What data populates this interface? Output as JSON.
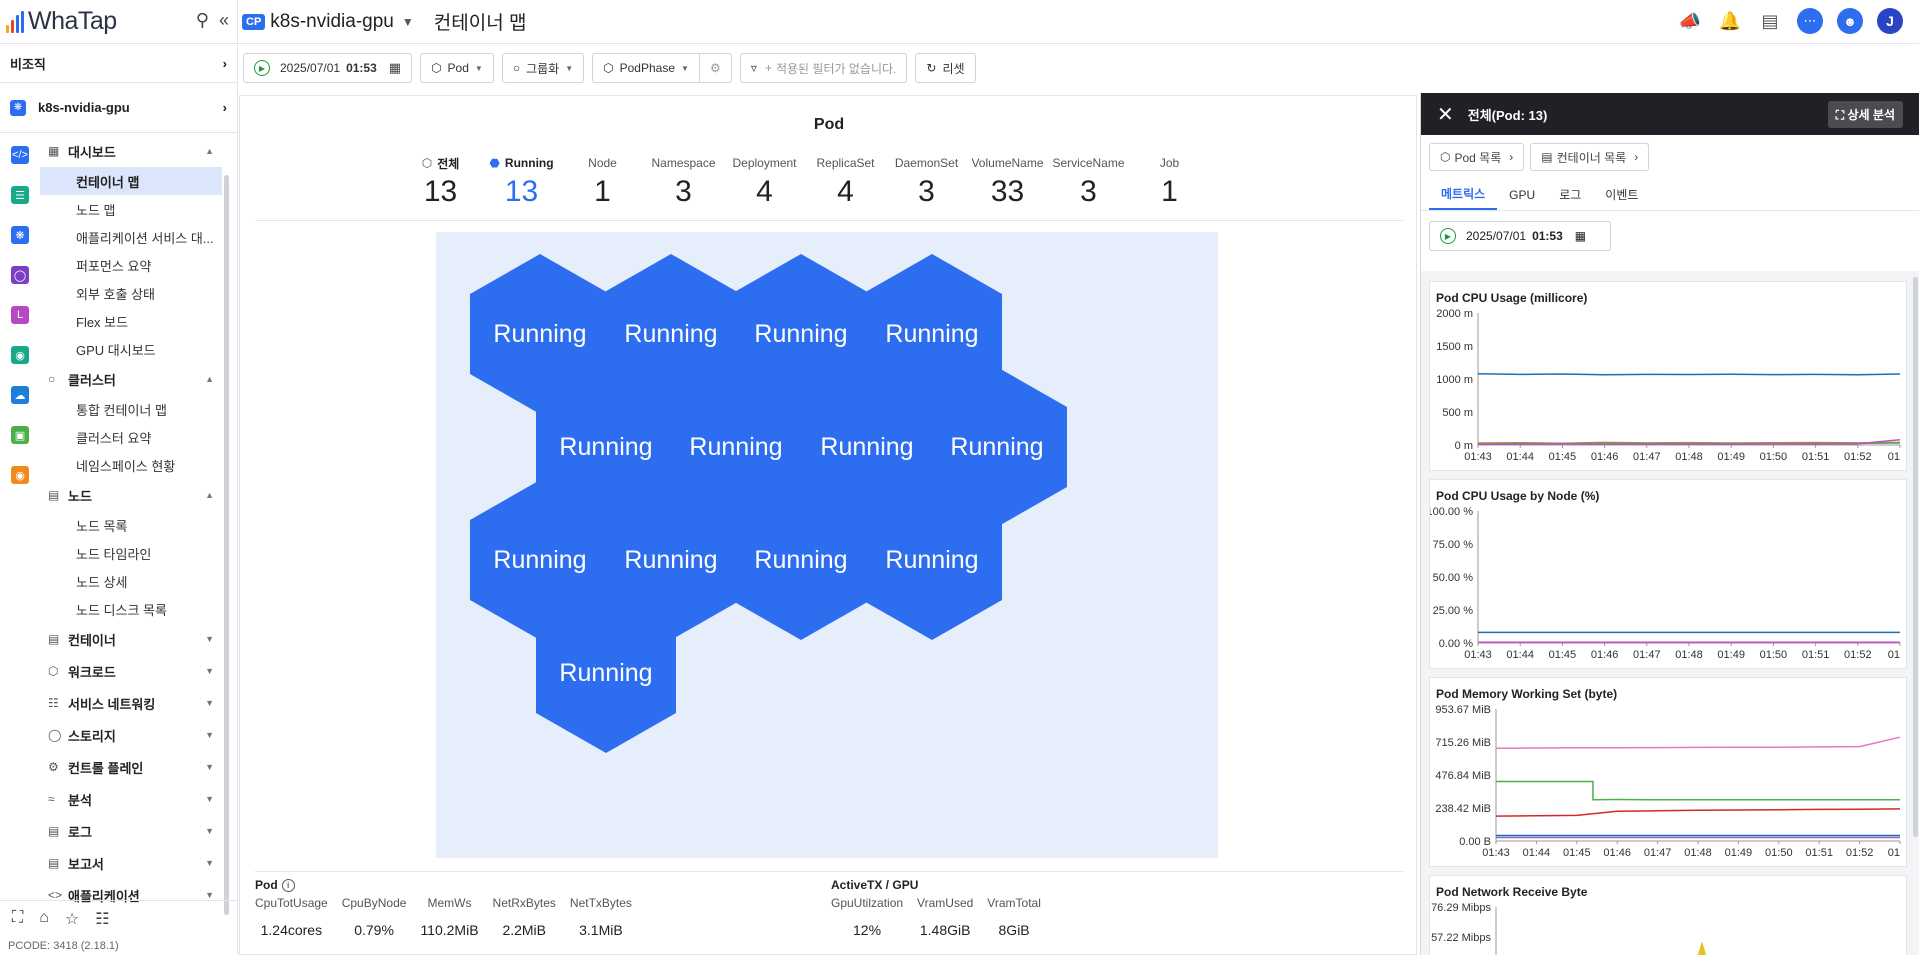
{
  "brand": {
    "name": "WhaTap"
  },
  "header": {
    "project_badge": "CP",
    "project_name": "k8s-nvidia-gpu",
    "page_title": "컨테이너 맵"
  },
  "sidebar": {
    "org_label": "비조직",
    "project_label": "k8s-nvidia-gpu",
    "sections": [
      {
        "label": "대시보드",
        "expanded": true,
        "items": [
          "컨테이너 맵",
          "노드 맵",
          "애플리케이션 서비스 대...",
          "퍼포먼스 요약",
          "외부 호출 상태",
          "Flex 보드",
          "GPU 대시보드"
        ]
      },
      {
        "label": "클러스터",
        "expanded": true,
        "items": [
          "통합 컨테이너 맵",
          "클러스터 요약",
          "네임스페이스 현황"
        ]
      },
      {
        "label": "노드",
        "expanded": true,
        "items": [
          "노드 목록",
          "노드 타임라인",
          "노드 상세",
          "노드 디스크 목록"
        ]
      },
      {
        "label": "컨테이너",
        "expanded": false,
        "items": []
      },
      {
        "label": "워크로드",
        "expanded": false,
        "items": []
      },
      {
        "label": "서비스 네트워킹",
        "expanded": false,
        "items": []
      },
      {
        "label": "스토리지",
        "expanded": false,
        "items": []
      },
      {
        "label": "컨트롤 플레인",
        "expanded": false,
        "items": []
      },
      {
        "label": "분석",
        "expanded": false,
        "items": []
      },
      {
        "label": "로그",
        "expanded": false,
        "items": []
      },
      {
        "label": "보고서",
        "expanded": false,
        "items": []
      },
      {
        "label": "애플리케이션",
        "expanded": false,
        "items": []
      }
    ],
    "active_item": "컨테이너 맵",
    "pcode": "PCODE: 3418 (2.18.1)"
  },
  "toolbar": {
    "date": "2025/07/01",
    "time": "01:53",
    "resource_select": "Pod",
    "group_select": "그룹화",
    "phase_select": "PodPhase",
    "filter_placeholder": "적용된 필터가 없습니다.",
    "reset_label": "리셋"
  },
  "main": {
    "title": "Pod",
    "stats": [
      {
        "label": "전체",
        "value": "13"
      },
      {
        "label": "Running",
        "value": "13"
      },
      {
        "label": "Node",
        "value": "1"
      },
      {
        "label": "Namespace",
        "value": "3"
      },
      {
        "label": "Deployment",
        "value": "4"
      },
      {
        "label": "ReplicaSet",
        "value": "4"
      },
      {
        "label": "DaemonSet",
        "value": "3"
      },
      {
        "label": "VolumeName",
        "value": "33"
      },
      {
        "label": "ServiceName",
        "value": "3"
      },
      {
        "label": "Job",
        "value": "1"
      }
    ],
    "pods": [
      "Running",
      "Running",
      "Running",
      "Running",
      "Running",
      "Running",
      "Running",
      "Running",
      "Running",
      "Running",
      "Running",
      "Running",
      "Running"
    ],
    "pod_color": "#2d6ef0",
    "metrics": {
      "pod_group_label": "Pod",
      "pod": [
        {
          "label": "CpuTotUsage",
          "value": "1.24cores"
        },
        {
          "label": "CpuByNode",
          "value": "0.79%"
        },
        {
          "label": "MemWs",
          "value": "110.2MiB"
        },
        {
          "label": "NetRxBytes",
          "value": "2.2MiB"
        },
        {
          "label": "NetTxBytes",
          "value": "3.1MiB"
        }
      ],
      "gpu_group_label": "ActiveTX / GPU",
      "gpu": [
        {
          "label": "GpuUtilzation",
          "value": "12%"
        },
        {
          "label": "VramUsed",
          "value": "1.48GiB"
        },
        {
          "label": "VramTotal",
          "value": "8GiB"
        }
      ]
    }
  },
  "panel": {
    "title": "전체(Pod: 13)",
    "detail_button": "상세 분석",
    "links": [
      "Pod 목록",
      "컨테이너 목록"
    ],
    "tabs": [
      "메트릭스",
      "GPU",
      "로그",
      "이벤트"
    ],
    "active_tab": "메트릭스",
    "date": "2025/07/01",
    "time": "01:53"
  },
  "chart_data": [
    {
      "type": "line",
      "title": "Pod CPU Usage (millicore)",
      "x": [
        "01:43",
        "01:44",
        "01:45",
        "01:46",
        "01:47",
        "01:48",
        "01:49",
        "01:50",
        "01:51",
        "01:52",
        "01"
      ],
      "yticks": [
        "2000 m",
        "1500 m",
        "1000 m",
        "500 m",
        "0 m"
      ],
      "ylim": [
        0,
        2000
      ],
      "series": [
        {
          "color": "#1f6fb5",
          "values": [
            1080,
            1070,
            1075,
            1065,
            1070,
            1068,
            1072,
            1066,
            1070,
            1065,
            1075
          ]
        },
        {
          "color": "#e07b39",
          "values": [
            30,
            35,
            28,
            40,
            32,
            36,
            30,
            34,
            38,
            32,
            40
          ]
        },
        {
          "color": "#49b04a",
          "values": [
            20,
            25,
            22,
            30,
            26,
            24,
            28,
            22,
            26,
            24,
            30
          ]
        },
        {
          "color": "#c44ec4",
          "values": [
            10,
            12,
            15,
            12,
            10,
            14,
            12,
            16,
            14,
            20,
            80
          ]
        }
      ]
    },
    {
      "type": "line",
      "title": "Pod CPU Usage by Node (%)",
      "x": [
        "01:43",
        "01:44",
        "01:45",
        "01:46",
        "01:47",
        "01:48",
        "01:49",
        "01:50",
        "01:51",
        "01:52",
        "01"
      ],
      "yticks": [
        "100.00 %",
        "75.00 %",
        "50.00 %",
        "25.00 %",
        "0.00 %"
      ],
      "ylim": [
        0,
        100
      ],
      "series": [
        {
          "color": "#1f6fb5",
          "values": [
            8,
            8,
            8,
            8,
            8,
            8,
            8,
            8,
            8,
            8,
            8
          ]
        },
        {
          "color": "#c44ec4",
          "values": [
            0.5,
            0.5,
            0.5,
            0.5,
            0.5,
            0.5,
            0.5,
            0.5,
            0.5,
            0.5,
            0.5
          ]
        }
      ]
    },
    {
      "type": "line",
      "title": "Pod Memory Working Set (byte)",
      "x": [
        "01:43",
        "01:44",
        "01:45",
        "01:46",
        "01:47",
        "01:48",
        "01:49",
        "01:50",
        "01:51",
        "01:52",
        "01"
      ],
      "yticks": [
        "953.67 MiB",
        "715.26 MiB",
        "476.84 MiB",
        "238.42 MiB",
        "0.00 B"
      ],
      "ylim": [
        0,
        953.67
      ],
      "series": [
        {
          "color": "#e377c2",
          "values": [
            670,
            672,
            673,
            674,
            675,
            676,
            677,
            678,
            680,
            682,
            750
          ]
        },
        {
          "color": "#49b04a",
          "values": [
            430,
            430,
            430,
            300,
            298,
            298,
            298,
            298,
            298,
            298,
            298
          ]
        },
        {
          "color": "#d62728",
          "values": [
            180,
            182,
            185,
            215,
            218,
            222,
            224,
            226,
            228,
            230,
            232
          ]
        },
        {
          "color": "#1f6fb5",
          "values": [
            40,
            40,
            40,
            40,
            40,
            40,
            40,
            40,
            40,
            40,
            40
          ]
        },
        {
          "color": "#9467bd",
          "values": [
            25,
            25,
            25,
            25,
            25,
            25,
            25,
            25,
            25,
            25,
            25
          ]
        }
      ]
    },
    {
      "type": "area",
      "title": "Pod Network Receive Byte",
      "yticks": [
        "76.29 Mibps",
        "57.22 Mibps"
      ]
    }
  ]
}
